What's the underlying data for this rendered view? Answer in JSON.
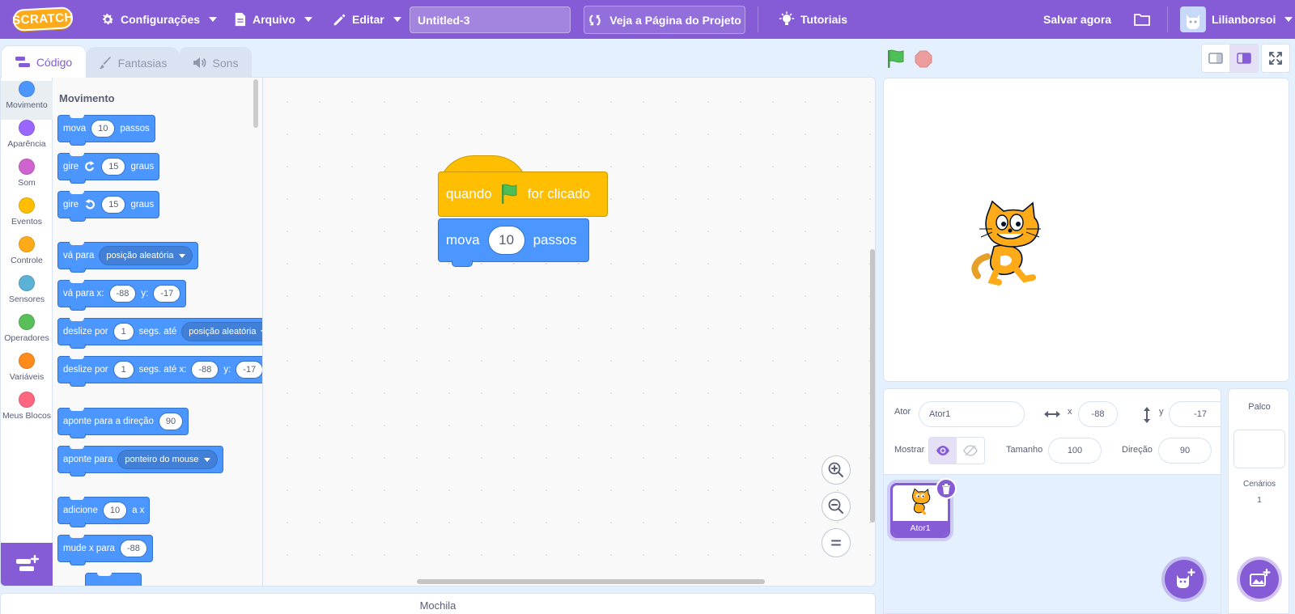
{
  "colors": {
    "accent": "#855cd6",
    "motion": "#4c97ff",
    "events": "#ffbf00",
    "background": "#e5f0ff"
  },
  "menubar": {
    "logo": "SCRATCH",
    "settings": "Configurações",
    "file": "Arquivo",
    "edit": "Editar",
    "project_title": "Untitled-3",
    "see_project": "Veja a Página do Projeto",
    "tutorials": "Tutoriais",
    "save_now": "Salvar agora",
    "username": "Lilianborsoi"
  },
  "tabs": {
    "code": "Código",
    "costumes": "Fantasias",
    "sounds": "Sons"
  },
  "categories": [
    {
      "label": "Movimento",
      "color": "#4c97ff"
    },
    {
      "label": "Aparência",
      "color": "#9966ff"
    },
    {
      "label": "Som",
      "color": "#cf63cf"
    },
    {
      "label": "Eventos",
      "color": "#ffbf00"
    },
    {
      "label": "Controle",
      "color": "#ffab19"
    },
    {
      "label": "Sensores",
      "color": "#5cb1d6"
    },
    {
      "label": "Operadores",
      "color": "#59c059"
    },
    {
      "label": "Variáveis",
      "color": "#ff8c1a"
    },
    {
      "label": "Meus Blocos",
      "color": "#ff6680"
    }
  ],
  "palette": {
    "title": "Movimento",
    "move": {
      "pre": "mova",
      "val": "10",
      "post": "passos"
    },
    "turn_right": {
      "pre": "gire",
      "val": "15",
      "post": "graus"
    },
    "turn_left": {
      "pre": "gire",
      "val": "15",
      "post": "graus"
    },
    "goto": {
      "pre": "vá para",
      "dd": "posição aleatória"
    },
    "goto_xy": {
      "pre": "vá para x:",
      "x": "-88",
      "ylabel": "y:",
      "y": "-17"
    },
    "glide": {
      "pre": "deslize por",
      "val": "1",
      "mid": "segs. até",
      "dd": "posição aleatória"
    },
    "glide_xy": {
      "pre": "deslize por",
      "val": "1",
      "mid": "segs. até x:",
      "x": "-88",
      "ylabel": "y:",
      "y": "-17"
    },
    "point_dir": {
      "pre": "aponte para a direção",
      "val": "90"
    },
    "point_to": {
      "pre": "aponte para",
      "dd": "ponteiro do mouse"
    },
    "change_x": {
      "pre": "adicione",
      "val": "10",
      "post": "a x"
    },
    "set_x": {
      "pre": "mude x para",
      "val": "-88"
    }
  },
  "script": {
    "hat": {
      "pre": "quando",
      "post": "for clicado"
    },
    "move": {
      "pre": "mova",
      "val": "10",
      "post": "passos"
    }
  },
  "backpack": "Mochila",
  "sprite": {
    "label": "Ator",
    "name": "Ator1",
    "x_label": "x",
    "x": "-88",
    "y_label": "y",
    "y": "-17",
    "show_label": "Mostrar",
    "size_label": "Tamanho",
    "size": "100",
    "direction_label": "Direção",
    "direction": "90",
    "tile_name": "Ator1"
  },
  "stage_pane": {
    "title": "Palco",
    "backdrops_label": "Cenários",
    "backdrops_count": "1"
  }
}
